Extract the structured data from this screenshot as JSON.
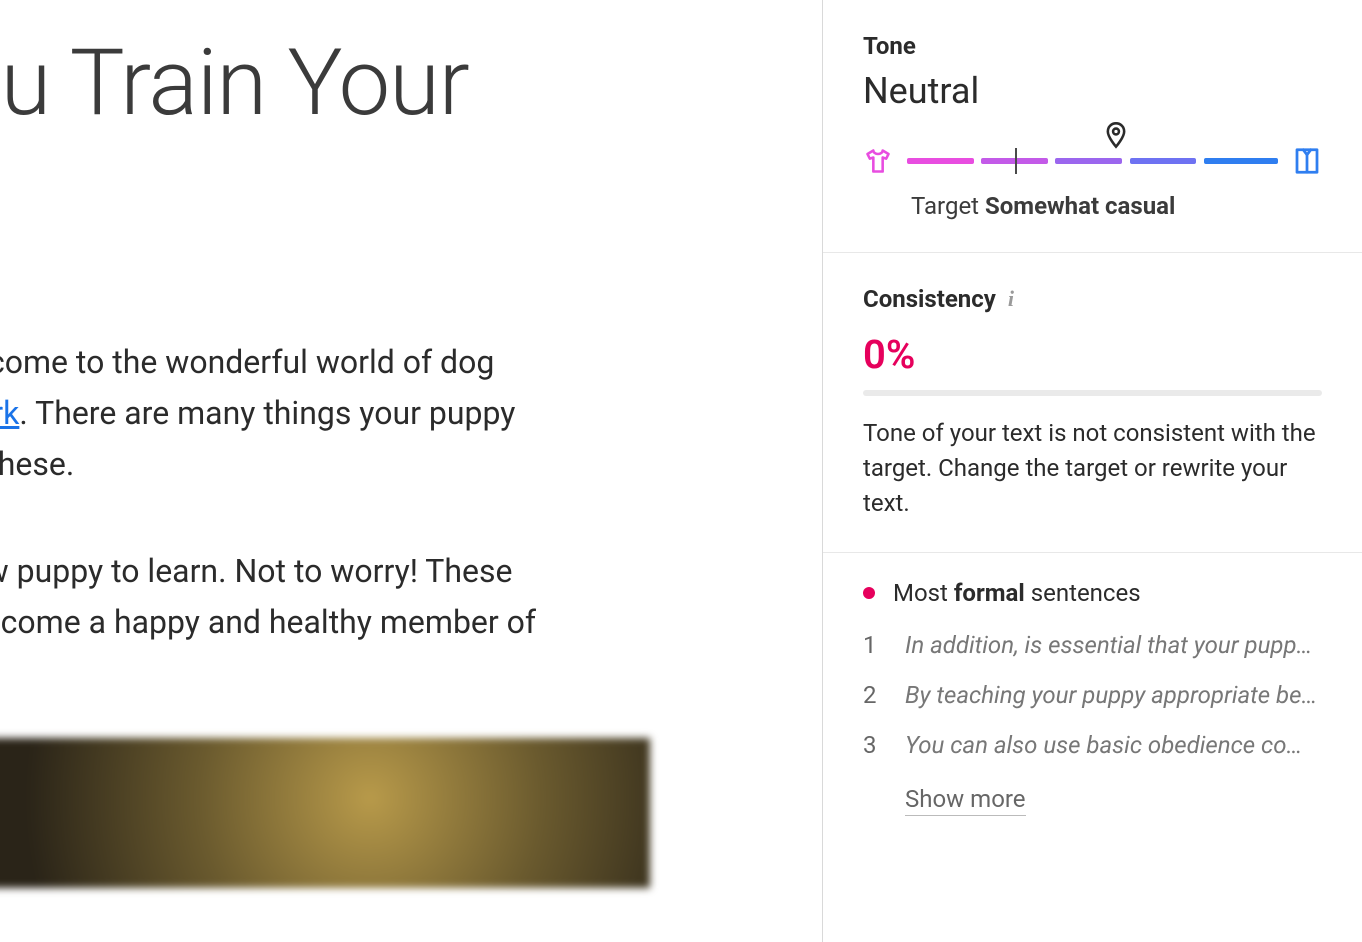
{
  "document": {
    "title_fragment": "ou Train Your",
    "paragraph1_prefix": "/elcome to the wonderful world of dog",
    "paragraph1_link": " work",
    "paragraph1_rest": ". There are many things your puppy",
    "paragraph1_line3": "of these.",
    "paragraph2_line1": "new puppy to learn. Not to worry! These",
    "paragraph2_line2": "l become a happy and healthy member of"
  },
  "tone": {
    "label": "Tone",
    "value": "Neutral",
    "target_prefix": "Target ",
    "target_value": "Somewhat casual"
  },
  "consistency": {
    "label": "Consistency",
    "value": "0%",
    "description": "Tone of your text is not consistent with the target. Change the target or rewrite your text."
  },
  "sentences": {
    "header_prefix": "Most ",
    "header_bold": "formal",
    "header_suffix": " sentences",
    "items": [
      {
        "num": "1",
        "text": "In addition, is essential that your puppy learns basic obedience commands early"
      },
      {
        "num": "2",
        "text": "By teaching your puppy appropriate behaviors from the start"
      },
      {
        "num": "3",
        "text": "You can also use basic obedience commands to reinforce"
      }
    ],
    "show_more": "Show more"
  },
  "colors": {
    "accent_pink": "#e6005c",
    "casual": "#e84de0",
    "formal": "#2f7ef0"
  }
}
